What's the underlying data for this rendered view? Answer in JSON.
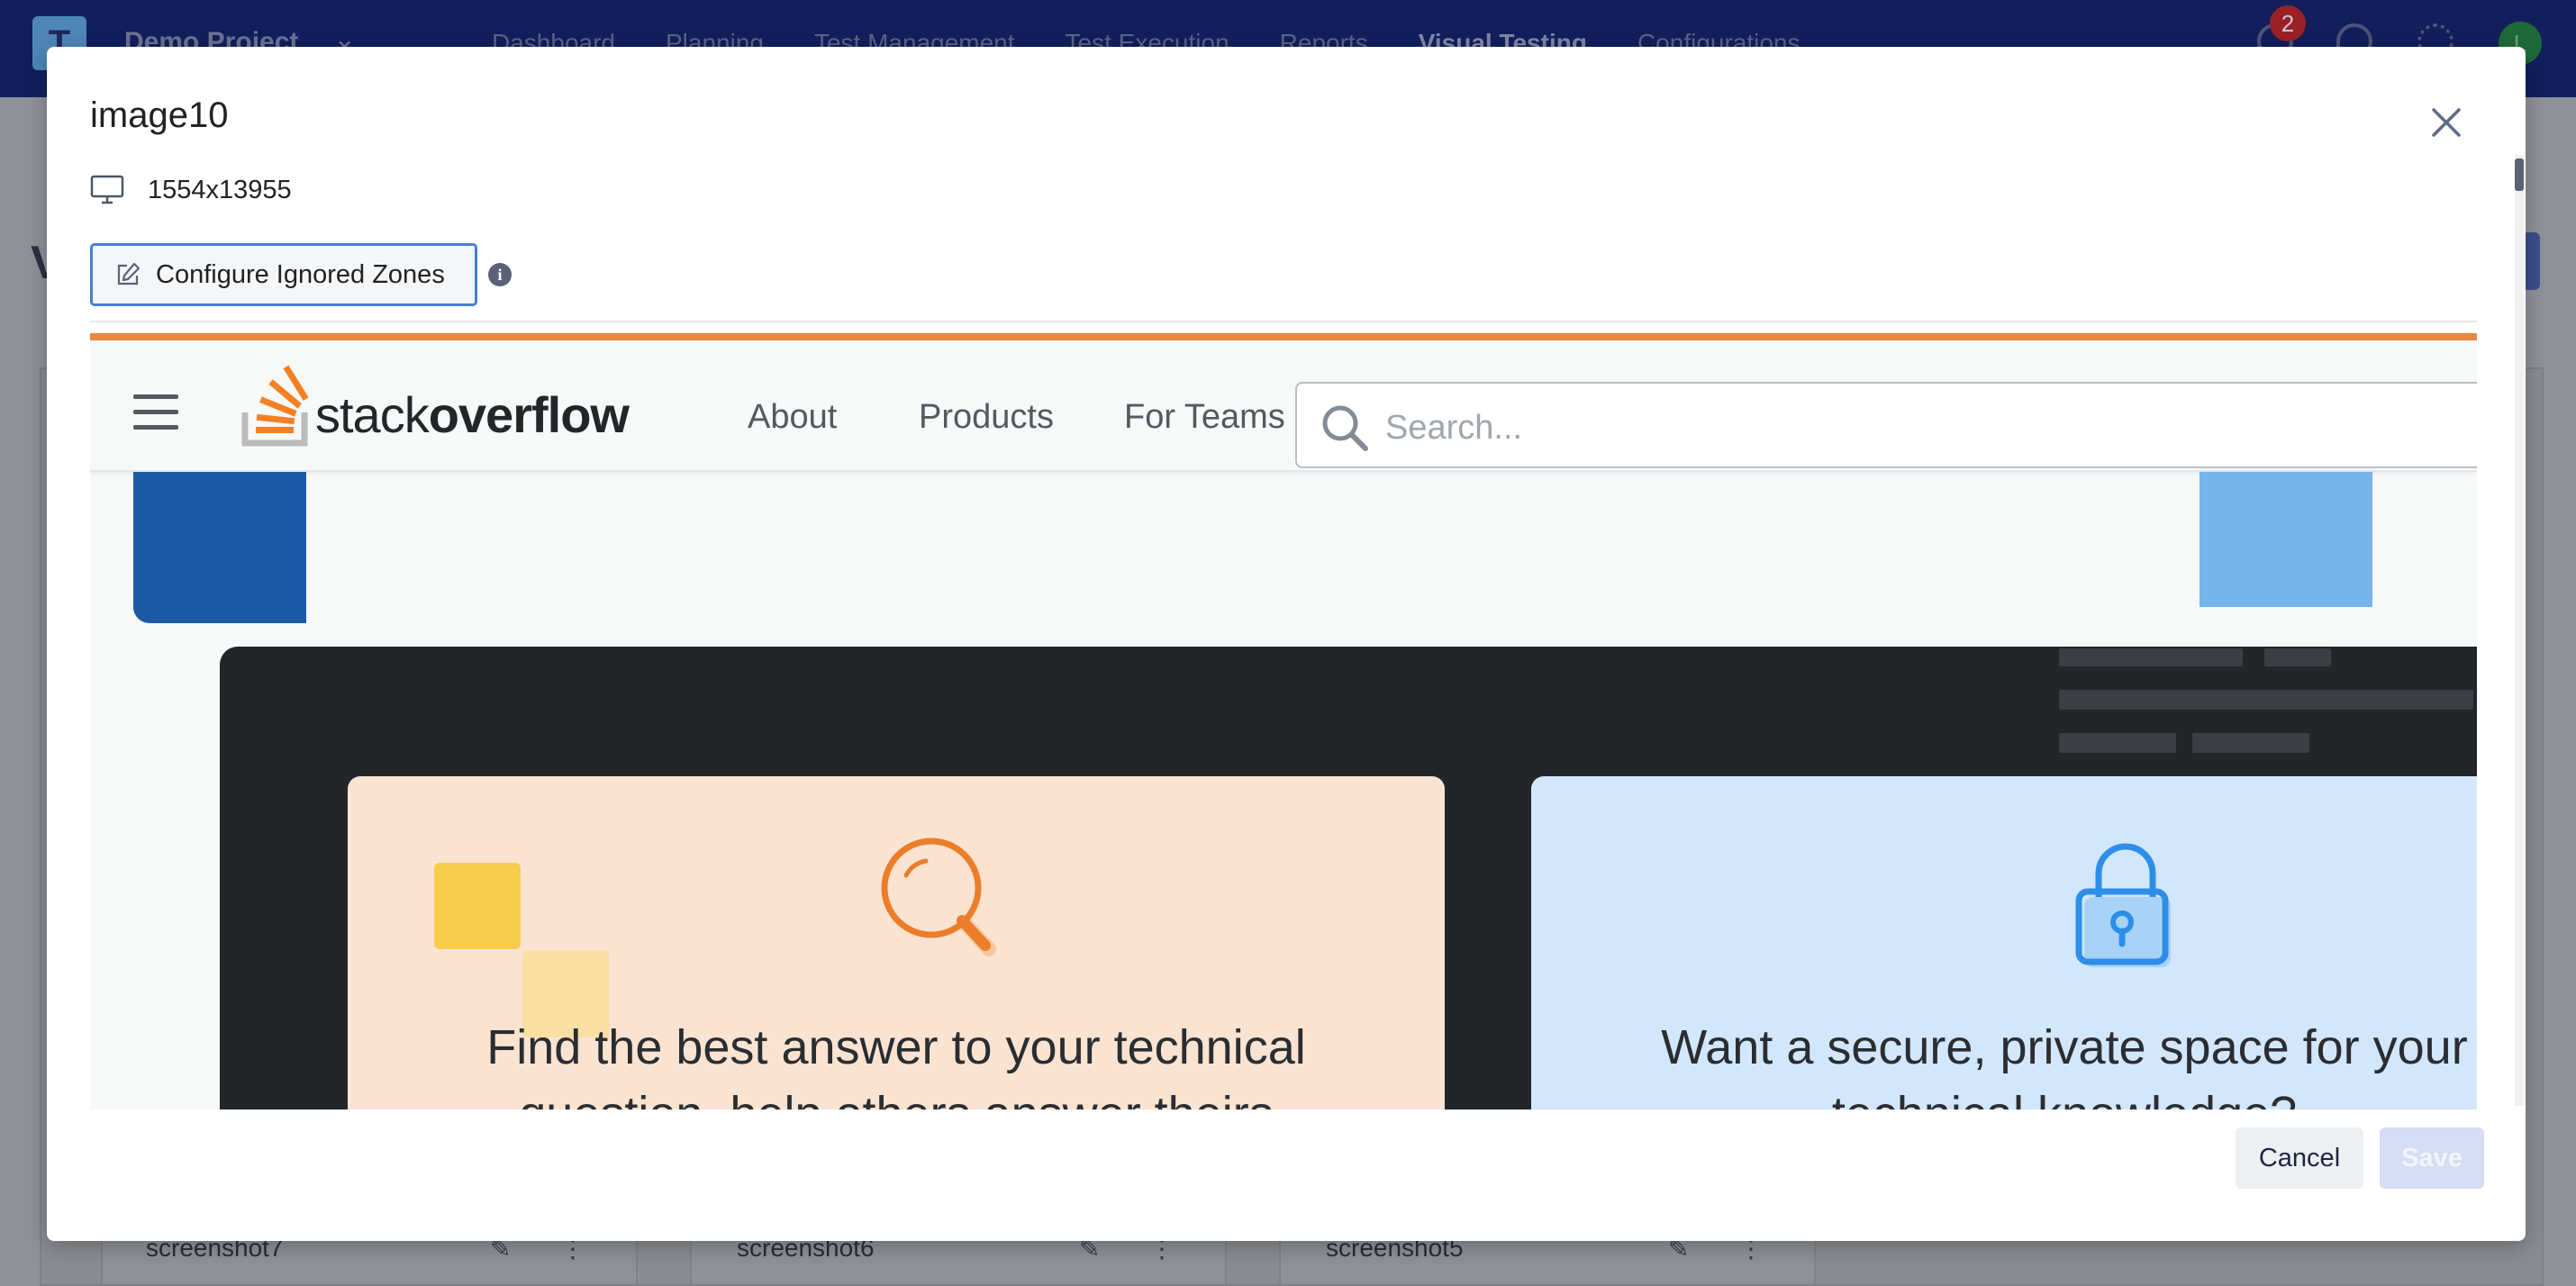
{
  "background_app": {
    "project_name": "Demo Project",
    "logo_letter": "T",
    "nav": [
      "Dashboard",
      "Planning",
      "Test Management",
      "Test Execution",
      "Reports",
      "Visual Testing",
      "Configurations"
    ],
    "active_nav": "Visual Testing",
    "notification_count": "2",
    "avatar_initial": "L",
    "page_heading_initial": "V",
    "cards": [
      "screenshot7",
      "screenshot6",
      "screenshot5"
    ]
  },
  "modal": {
    "title": "image10",
    "resolution": "1554x13955",
    "configure_button": "Configure Ignored Zones",
    "info_icon": "i",
    "cancel_label": "Cancel",
    "save_label": "Save"
  },
  "preview": {
    "brand_light": "stack",
    "brand_bold": "overflow",
    "nav": [
      "About",
      "Products",
      "For Teams"
    ],
    "search_placeholder": "Search...",
    "card_left_text": [
      "Find the best answer to your technical",
      "question, help others answer theirs"
    ],
    "card_right_text": [
      "Want a secure, private space for your",
      "technical knowledge?"
    ]
  },
  "colors": {
    "nav_bg": "#121f5c",
    "accent_blue": "#4a7ed1",
    "so_orange": "#e7883a"
  }
}
